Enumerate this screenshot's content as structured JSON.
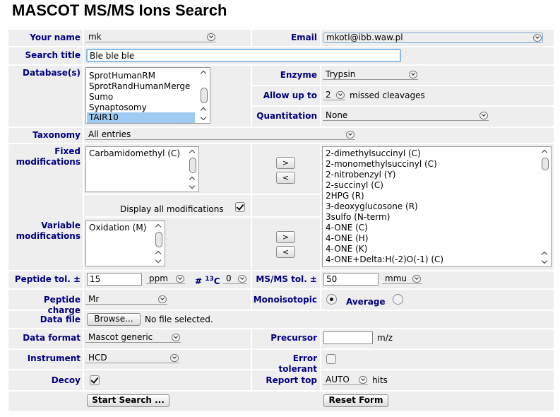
{
  "title": "MASCOT MS/MS Ions Search",
  "labels": {
    "your_name": "Your name",
    "email": "Email",
    "search_title": "Search title",
    "databases": "Database(s)",
    "enzyme": "Enzyme",
    "allow_up_to": "Allow up to",
    "missed_cleavages": "missed cleavages",
    "quantitation": "Quantitation",
    "taxonomy": "Taxonomy",
    "fixed_mods_1": "Fixed",
    "fixed_mods_2": "modifications",
    "display_all_mods": "Display all modifications",
    "variable_mods_1": "Variable",
    "variable_mods_2": "modifications",
    "peptide_tol": "Peptide tol. ±",
    "c13_prefix": "#",
    "c13_sup": "13",
    "c13_suffix": "C",
    "msms_tol": "MS/MS tol. ±",
    "peptide_charge": "Peptide charge",
    "monoisotopic": "Monoisotopic",
    "average": "Average",
    "data_file": "Data file",
    "no_file": "No file selected.",
    "data_format": "Data format",
    "precursor": "Precursor",
    "mz": "m/z",
    "instrument": "Instrument",
    "error_tolerant": "Error tolerant",
    "decoy": "Decoy",
    "report_top": "Report top",
    "hits": "hits"
  },
  "values": {
    "your_name": "mk",
    "email": "mkotl@ibb.waw.pl",
    "search_title": "Ble ble ble",
    "enzyme": "Trypsin",
    "missed_cleavages": "2",
    "quantitation": "None",
    "taxonomy": "All entries",
    "peptide_tol": "15",
    "peptide_tol_unit": "ppm",
    "c13": "0",
    "msms_tol": "50",
    "msms_tol_unit": "mmu",
    "peptide_charge": "Mr",
    "data_format": "Mascot generic",
    "precursor": "",
    "instrument": "HCD",
    "report_top": "AUTO"
  },
  "databases": [
    "SprotHumanRM",
    "SprotRandHumanMerge",
    "Sumo",
    "Synaptosomy",
    "TAIR10"
  ],
  "fixed_mods": [
    "Carbamidomethyl (C)"
  ],
  "variable_mods": [
    "Oxidation (M)"
  ],
  "all_mods": [
    "2-dimethylsuccinyl (C)",
    "2-monomethylsuccinyl (C)",
    "2-nitrobenzyl (Y)",
    "2-succinyl (C)",
    "2HPG (R)",
    "3-deoxyglucosone (R)",
    "3sulfo (N-term)",
    "4-ONE (C)",
    "4-ONE (H)",
    "4-ONE (K)",
    "4-ONE+Delta:H(-2)O(-1) (C)"
  ],
  "buttons": {
    "add": ">",
    "remove": "<",
    "browse": "Browse...",
    "start_search": "Start Search ...",
    "reset_form": "Reset Form"
  },
  "colors": {
    "label": "#000080",
    "cell_bg": "#eeeeee",
    "selected_item": "#9ecbf1"
  }
}
